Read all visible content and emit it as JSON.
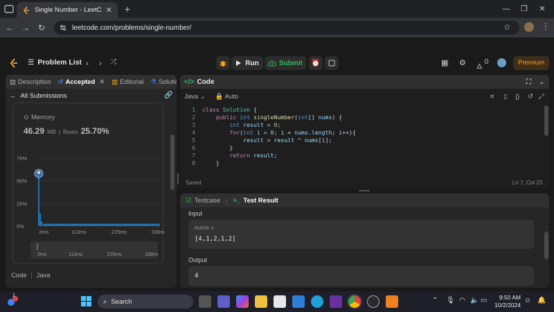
{
  "browser": {
    "tab_title": "Single Number - LeetCode",
    "url": "leetcode.com/problems/single-number/"
  },
  "topbar": {
    "problem_list": "Problem List",
    "run": "Run",
    "submit": "Submit",
    "streak_count": "0",
    "premium": "Premium"
  },
  "left_panel": {
    "tabs": [
      "Description",
      "Accepted",
      "Editorial",
      "Solutio"
    ],
    "all_submissions": "All Submissions",
    "memory_title": "Memory",
    "memory_value": "46.29",
    "memory_unit": "MB",
    "beats_label": "Beats",
    "beats_value": "25.70%",
    "footer_code": "Code",
    "footer_lang": "Java"
  },
  "chart_data": {
    "type": "bar",
    "y_ticks": [
      "75%",
      "50%",
      "25%",
      "0%"
    ],
    "x_ticks": [
      "2ms",
      "113ms",
      "225ms",
      "336ms"
    ],
    "range_ticks": [
      "2ms",
      "113ms",
      "225ms",
      "336ms"
    ],
    "ylim": [
      0,
      75
    ],
    "xlim": [
      2,
      336
    ],
    "bars": [
      {
        "x": 2,
        "y": 62
      },
      {
        "x": 6,
        "y": 14
      },
      {
        "x": 10,
        "y": 5
      }
    ],
    "tail_level": 2.5,
    "highlight": {
      "x": 2,
      "y": 58
    }
  },
  "code_panel": {
    "title": "Code",
    "language": "Java",
    "mode": "Auto",
    "saved": "Saved",
    "cursor": "Ln 7, Col 23",
    "lines": [
      "class Solution {",
      "    public int singleNumber(int[] nums) {",
      "        int result = 0;",
      "        for(int i = 0; i < nums.length; i++){",
      "            result = result ^ nums[i];",
      "        }",
      "        return result;",
      "    }"
    ]
  },
  "test_panel": {
    "testcase": "Testcase",
    "result": "Test Result",
    "input_label": "Input",
    "var_name": "nums =",
    "input_value": "[4,1,2,1,2]",
    "output_label": "Output",
    "output_value": "4"
  },
  "taskbar": {
    "search": "Search",
    "time": "9:50 AM",
    "date": "10/2/2024",
    "notif_count": "1"
  },
  "colors": {
    "accent_orange": "#ffa116",
    "accent_green": "#2cbb5d",
    "chart_blue": "#1f8ad9"
  }
}
